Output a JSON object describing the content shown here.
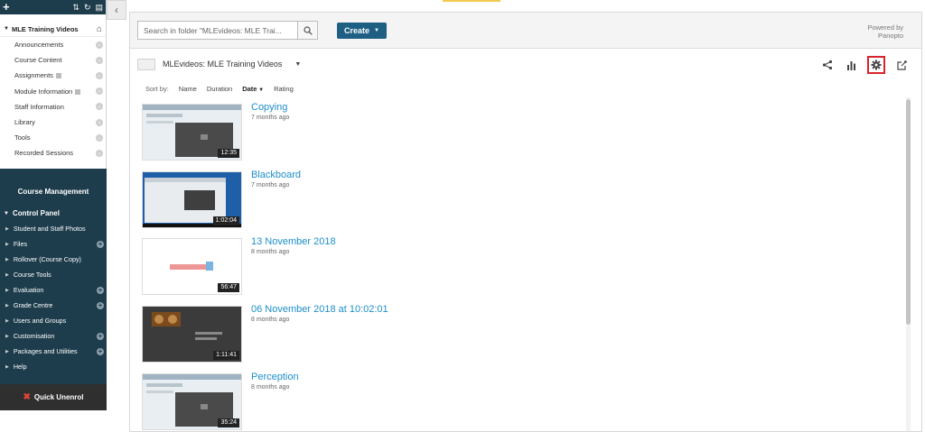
{
  "sidebar": {
    "course_title": "MLE Training Videos",
    "items": [
      {
        "label": "Announcements",
        "has_icon": false
      },
      {
        "label": "Course Content",
        "has_icon": false
      },
      {
        "label": "Assignments",
        "has_icon": true
      },
      {
        "label": "Module Information",
        "has_icon": true
      },
      {
        "label": "Staff Information",
        "has_icon": false
      },
      {
        "label": "Library",
        "has_icon": false
      },
      {
        "label": "Tools",
        "has_icon": false
      },
      {
        "label": "Recorded Sessions",
        "has_icon": false
      }
    ],
    "management_title": "Course Management",
    "control_panel": "Control Panel",
    "panel_items": [
      {
        "label": "Student and Staff Photos",
        "plus": false
      },
      {
        "label": "Files",
        "plus": true
      },
      {
        "label": "Rollover (Course Copy)",
        "plus": false
      },
      {
        "label": "Course Tools",
        "plus": false
      },
      {
        "label": "Evaluation",
        "plus": true
      },
      {
        "label": "Grade Centre",
        "plus": true
      },
      {
        "label": "Users and Groups",
        "plus": false
      },
      {
        "label": "Customisation",
        "plus": true
      },
      {
        "label": "Packages and Utilities",
        "plus": true
      },
      {
        "label": "Help",
        "plus": false
      }
    ],
    "quick_unenrol": "Quick Unenrol"
  },
  "panopto": {
    "search_placeholder": "Search in folder \"MLEvideos: MLE Trai...",
    "create_label": "Create",
    "powered_by_line1": "Powered by",
    "powered_by_line2": "Panopto",
    "folder_name": "MLEvideos: MLE Training Videos",
    "sort": {
      "label": "Sort by:",
      "options": [
        "Name",
        "Duration",
        "Date",
        "Rating"
      ],
      "active": "Date"
    },
    "sessions": [
      {
        "title": "Copying",
        "age": "7 months ago",
        "duration": "12:35"
      },
      {
        "title": "Blackboard",
        "age": "7 months ago",
        "duration": "1:02:04"
      },
      {
        "title": "13 November 2018",
        "age": "8 months ago",
        "duration": "56:47"
      },
      {
        "title": "06 November 2018 at 10:02:01",
        "age": "8 months ago",
        "duration": "1:11:41"
      },
      {
        "title": "Perception",
        "age": "8 months ago",
        "duration": "35:24"
      }
    ]
  },
  "colors": {
    "sidebar_dark": "#1d3c4c",
    "create_button": "#1e5f83",
    "link_blue": "#1c8ec9",
    "highlight_red": "#d9242a"
  }
}
